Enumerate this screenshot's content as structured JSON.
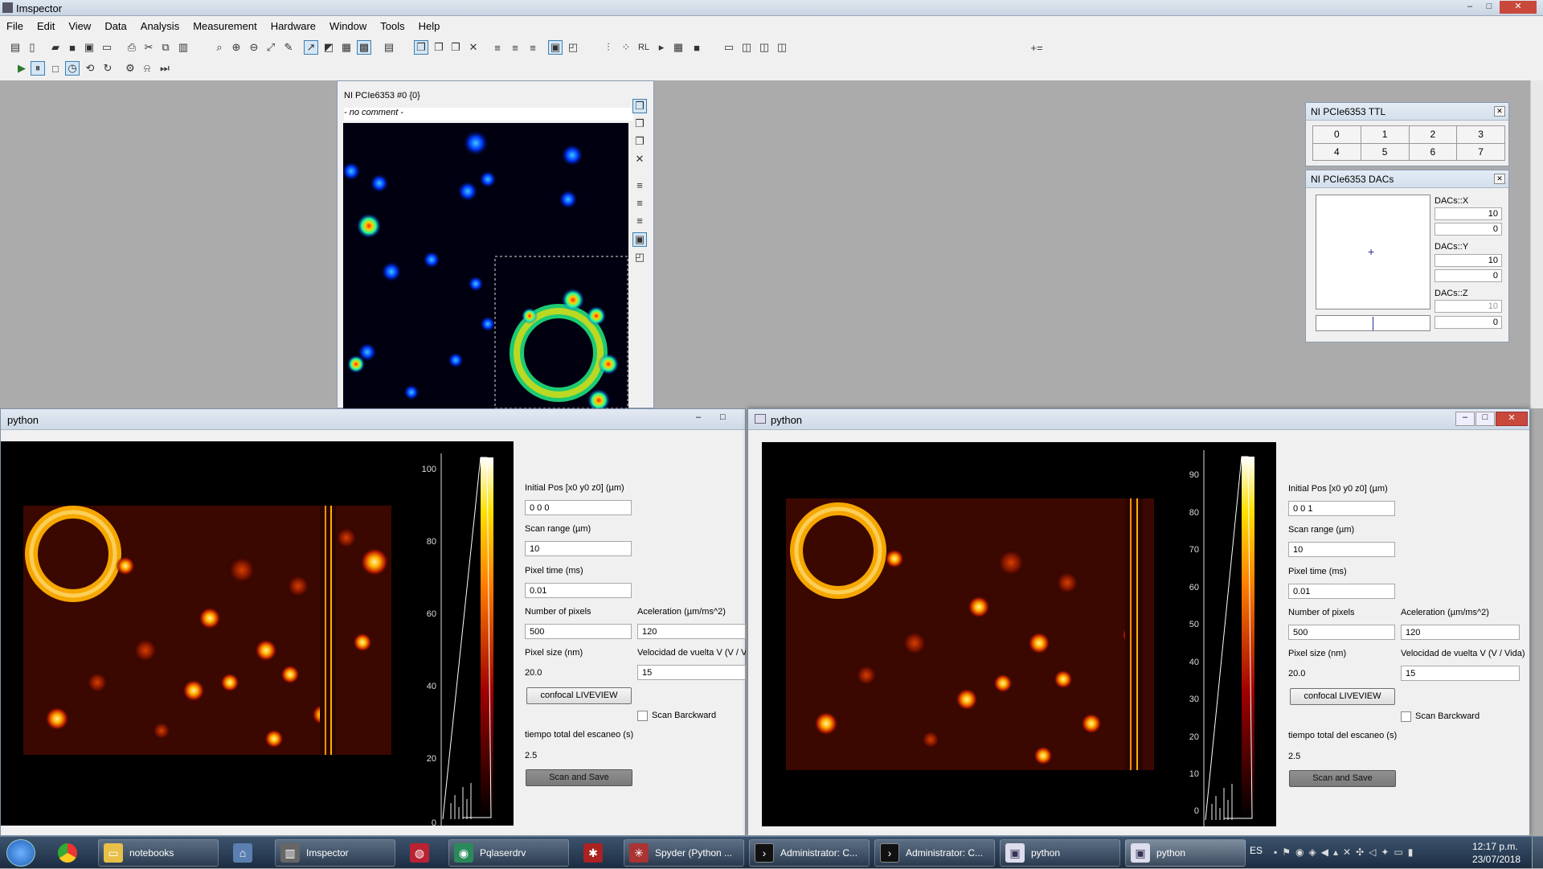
{
  "app": {
    "title": "Imspector",
    "minimize": "–",
    "maximize": "□",
    "close": "✕"
  },
  "menu": [
    "File",
    "Edit",
    "View",
    "Data",
    "Analysis",
    "Measurement",
    "Hardware",
    "Window",
    "Tools",
    "Help"
  ],
  "toolbar": {
    "extra_label": "+="
  },
  "image_window": {
    "title": "NI PCIe6353 #0 {0}",
    "comment": "- no comment -"
  },
  "ttl_panel": {
    "title": "NI PCIe6353 TTL",
    "channels": [
      "0",
      "1",
      "2",
      "3",
      "4",
      "5",
      "6",
      "7"
    ]
  },
  "dac_panel": {
    "title": "NI PCIe6353 DACs",
    "x_label": "DACs::X",
    "x_max": "10",
    "x_min": "0",
    "y_label": "DACs::Y",
    "y_max": "10",
    "y_min": "0",
    "z_label": "DACs::Z",
    "z_max": "10",
    "z_min": "0"
  },
  "python_left": {
    "title": "python",
    "colorbar_ticks": [
      "100",
      "80",
      "60",
      "40",
      "20",
      "0"
    ],
    "initial_pos_label": "Initial Pos [x0 y0 z0] (µm)",
    "initial_pos": "0 0 0",
    "scan_range_label": "Scan range (µm)",
    "scan_range": "10",
    "pixel_time_label": "Pixel time (ms)",
    "pixel_time": "0.01",
    "num_pixels_label": "Number of pixels",
    "num_pixels": "500",
    "acceleration_label": "Aceleration (µm/ms^2)",
    "acceleration": "120",
    "pixel_size_label": "Pixel size (nm)",
    "pixel_size": "20.0",
    "velocity_label": "Velocidad de vuelta V (V / Vida)",
    "velocity": "15",
    "liveview_button": "confocal LIVEVIEW",
    "scan_backward_label": "Scan Barckward",
    "total_time_label": "tiempo total del escaneo (s)",
    "total_time": "2.5",
    "scan_save_button": "Scan and Save"
  },
  "python_right": {
    "title": "python",
    "colorbar_ticks": [
      "90",
      "80",
      "70",
      "60",
      "50",
      "40",
      "30",
      "20",
      "10",
      "0"
    ],
    "initial_pos_label": "Initial Pos [x0 y0 z0] (µm)",
    "initial_pos": "0 0 1",
    "scan_range_label": "Scan range (µm)",
    "scan_range": "10",
    "pixel_time_label": "Pixel time (ms)",
    "pixel_time": "0.01",
    "num_pixels_label": "Number of pixels",
    "num_pixels": "500",
    "acceleration_label": "Aceleration (µm/ms^2)",
    "acceleration": "120",
    "pixel_size_label": "Pixel size (nm)",
    "pixel_size": "20.0",
    "velocity_label": "Velocidad de vuelta V (V / Vida)",
    "velocity": "15",
    "liveview_button": "confocal LIVEVIEW",
    "scan_backward_label": "Scan Barckward",
    "total_time_label": "tiempo total del escaneo (s)",
    "total_time": "2.5",
    "scan_save_button": "Scan and Save"
  },
  "taskbar": {
    "items": [
      {
        "label": "notebooks",
        "icon": "folder-icon"
      },
      {
        "label": "Imspector",
        "icon": "imspector-icon"
      },
      {
        "label": "Pqlaserdrv",
        "icon": "laser-driver-icon"
      },
      {
        "label": "Spyder (Python ...",
        "icon": "spyder-icon"
      },
      {
        "label": "Administrator: C...",
        "icon": "cmd-icon"
      },
      {
        "label": "Administrator: C...",
        "icon": "cmd-icon"
      },
      {
        "label": "python",
        "icon": "python-window-icon"
      },
      {
        "label": "python",
        "icon": "python-window-icon"
      }
    ],
    "language": "ES",
    "time": "12:17 p.m.",
    "date": "23/07/2018"
  }
}
